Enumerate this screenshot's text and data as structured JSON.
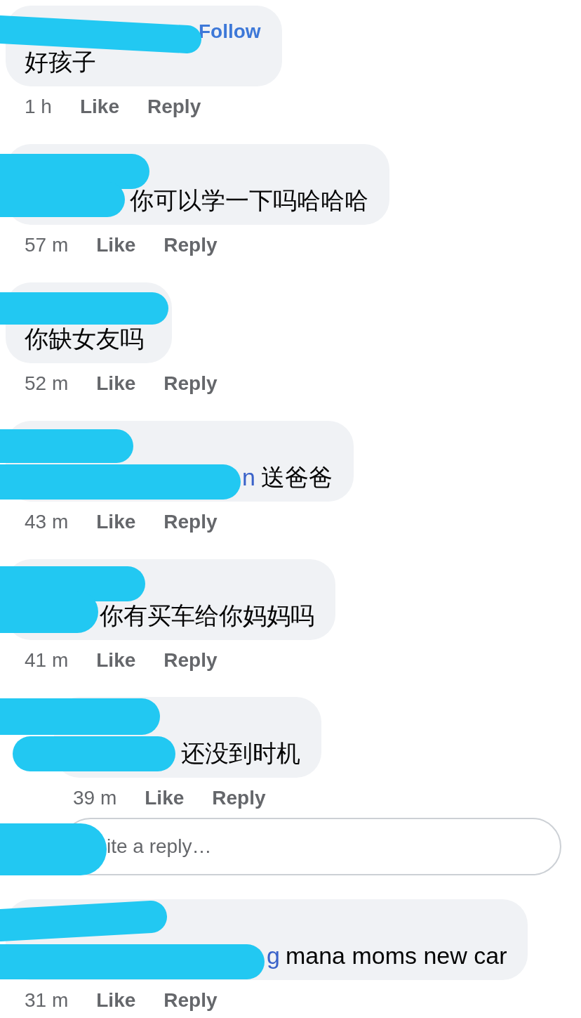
{
  "comments": [
    {
      "follow": "Follow",
      "text": "好孩子",
      "time": "1 h",
      "like": "Like",
      "reply": "Reply"
    },
    {
      "text": "你可以学一下吗哈哈哈",
      "time": "57 m",
      "like": "Like",
      "reply": "Reply"
    },
    {
      "text": "你缺女友吗",
      "time": "52 m",
      "like": "Like",
      "reply": "Reply"
    },
    {
      "mention": "n",
      "text": "送爸爸",
      "time": "43 m",
      "like": "Like",
      "reply": "Reply"
    },
    {
      "text": "你有买车给你妈妈吗",
      "time": "41 m",
      "like": "Like",
      "reply": "Reply",
      "replies": [
        {
          "text": "还没到时机",
          "time": "39 m",
          "like": "Like",
          "reply": "Reply"
        }
      ],
      "reply_box": {
        "placeholder": "ite a reply…"
      }
    },
    {
      "mention": "g",
      "text": "mana moms new car",
      "time": "31 m",
      "like": "Like",
      "reply": "Reply"
    }
  ]
}
